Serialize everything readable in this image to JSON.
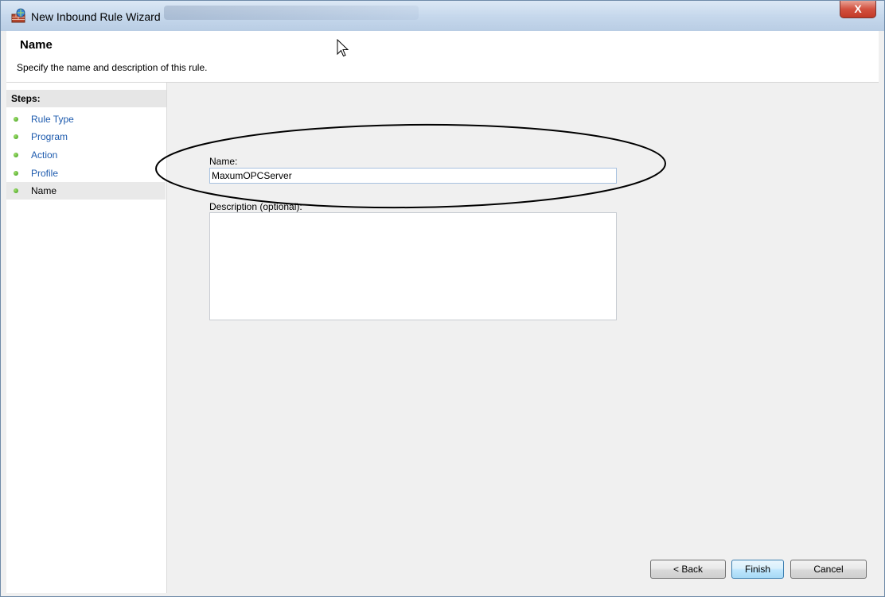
{
  "window": {
    "title": "New Inbound Rule Wizard",
    "close_glyph": "X"
  },
  "header": {
    "title": "Name",
    "description": "Specify the name and description of this rule."
  },
  "sidebar": {
    "steps_label": "Steps:",
    "items": [
      {
        "label": "Rule Type",
        "active": false
      },
      {
        "label": "Program",
        "active": false
      },
      {
        "label": "Action",
        "active": false
      },
      {
        "label": "Profile",
        "active": false
      },
      {
        "label": "Name",
        "active": true
      }
    ]
  },
  "form": {
    "name_label": "Name:",
    "name_value": "MaxumOPCServer",
    "description_label": "Description (optional):",
    "description_value": ""
  },
  "buttons": {
    "back": "< Back",
    "finish": "Finish",
    "cancel": "Cancel"
  },
  "colors": {
    "link": "#1e5bae",
    "step_dot": "#4caf2a",
    "close_button": "#c9432f"
  }
}
